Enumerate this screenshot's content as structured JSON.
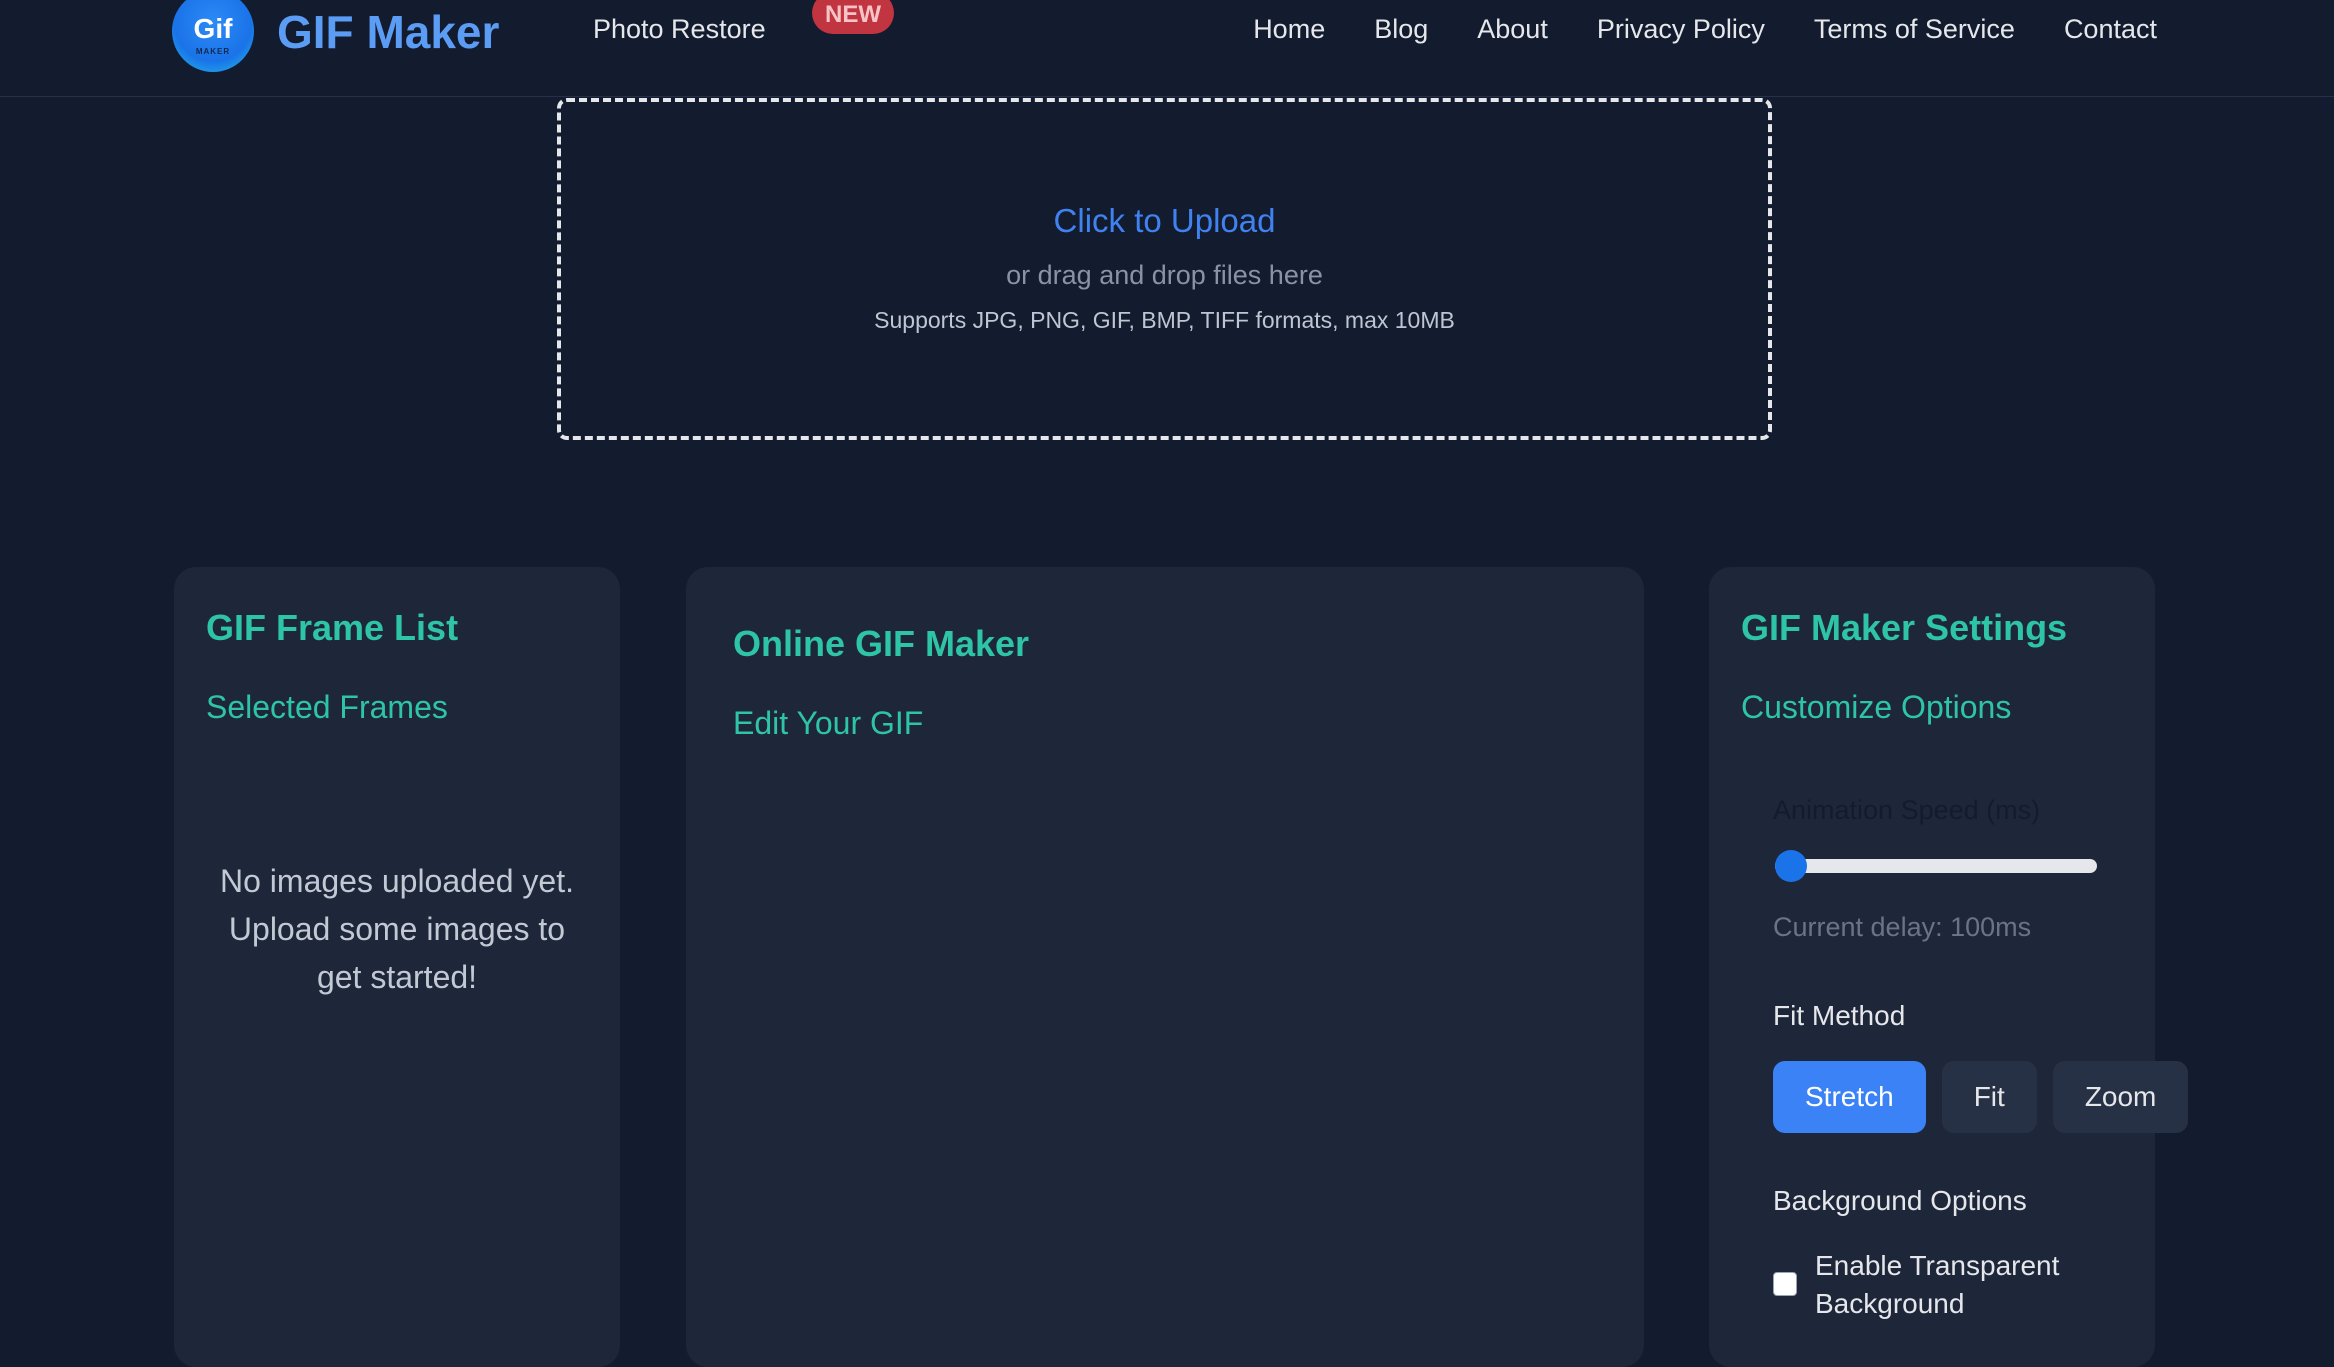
{
  "nav": {
    "logo_text": "Gif",
    "logo_subtext": "MAKER",
    "brand": "GIF Maker",
    "photo_restore": "Photo Restore",
    "new_badge": "NEW",
    "links": [
      "Home",
      "Blog",
      "About",
      "Privacy Policy",
      "Terms of Service",
      "Contact"
    ]
  },
  "upload": {
    "title": "Click to Upload",
    "subtitle": "or drag and drop files here",
    "formats": "Supports JPG, PNG, GIF, BMP, TIFF formats, max 10MB"
  },
  "frame_list": {
    "title": "GIF Frame List",
    "subtitle": "Selected Frames",
    "empty_message": "No images uploaded yet. Upload some images to get started!"
  },
  "editor": {
    "title": "Online GIF Maker",
    "subtitle": "Edit Your GIF"
  },
  "settings": {
    "title": "GIF Maker Settings",
    "subtitle": "Customize Options",
    "speed_label": "Animation Speed (ms)",
    "speed_fraction": 0.0,
    "current_delay": "Current delay: 100ms",
    "fit_label": "Fit Method",
    "fit_options": [
      "Stretch",
      "Fit",
      "Zoom"
    ],
    "fit_selected": "Stretch",
    "background_label": "Background Options",
    "transparent_label": "Enable Transparent Background",
    "transparent_checked": false
  },
  "colors": {
    "page_bg": "#131b2e",
    "panel_bg": "#1e2739",
    "accent_teal": "#2ec4a6",
    "accent_blue": "#3b82f6",
    "brand_blue": "#5b9cf4",
    "badge_red": "#c0353f"
  }
}
